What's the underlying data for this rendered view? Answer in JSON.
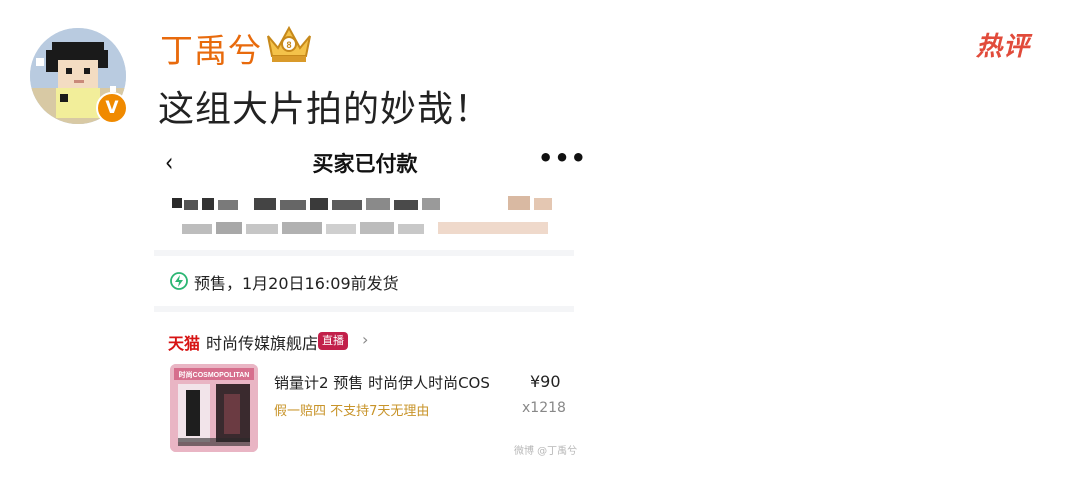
{
  "post": {
    "username": "丁禹兮",
    "text": "这组大片拍的妙哉！",
    "verified_mark": "V",
    "hot_label": "热评"
  },
  "order": {
    "nav": {
      "back_glyph": "‹",
      "title": "买家已付款",
      "more_glyph": "•••"
    },
    "shipping_text": "预售，1月20日16:09前发货",
    "store": {
      "platform": "天猫",
      "name": "时尚传媒旗舰店",
      "live_badge": "直播",
      "chevron": "›"
    },
    "product": {
      "title": "销量计2 预售 时尚伊人时尚COS",
      "price": "¥90",
      "tags": "假一赔四  不支持7天无理由",
      "quantity": "x1218",
      "cover_text": "时尚COSMOPOLITAN"
    },
    "watermark": "微博 @丁禹兮"
  },
  "colors": {
    "username": "#e86a0c",
    "hot_label": "#e14b3b",
    "tmall": "#d71414",
    "tag_gold": "#c8942a",
    "live_badge": "#c2204a",
    "verified": "#f08a00"
  },
  "icons": {
    "avatar": "pixel-art-avatar",
    "crown": "crown-icon",
    "shipping": "lightning-circle-icon"
  }
}
